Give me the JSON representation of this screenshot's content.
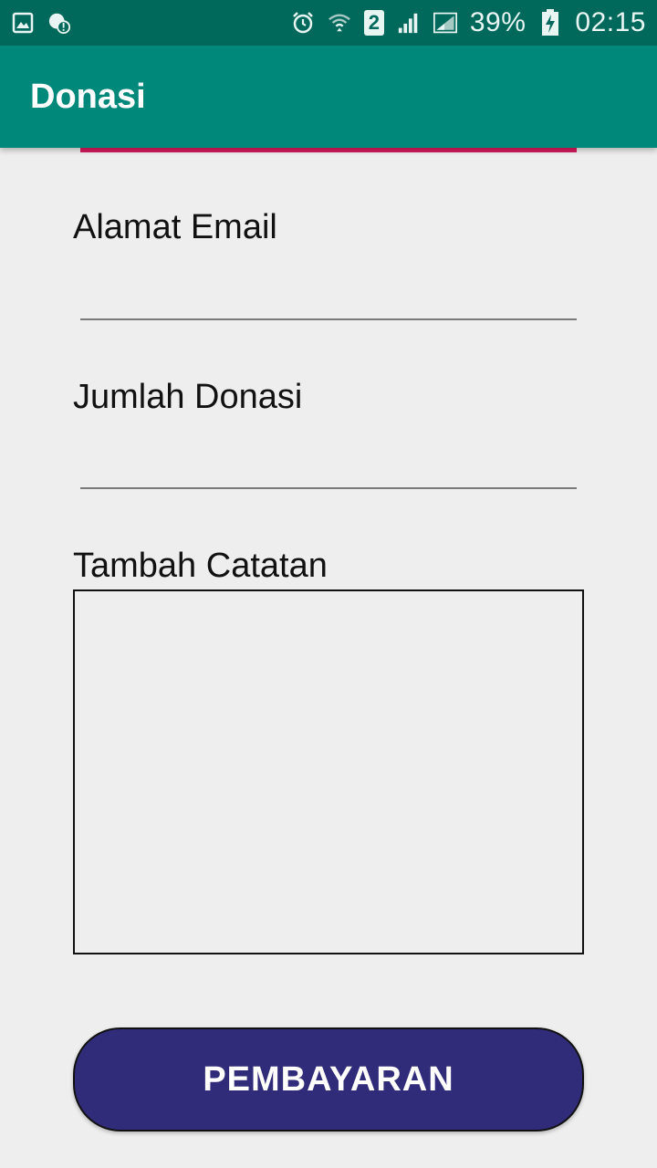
{
  "status_bar": {
    "left_icons": [
      "gallery-icon",
      "notification-alert-icon"
    ],
    "right_icons": [
      "alarm-icon",
      "wifi-icon",
      "sim2-icon",
      "signal-icon",
      "signal2-icon"
    ],
    "sim_label": "2",
    "battery_percent": "39%",
    "time": "02:15"
  },
  "app_bar": {
    "title": "Donasi",
    "color": "#00897b"
  },
  "form": {
    "email_label": "Alamat Email",
    "email_value": "",
    "amount_label": "Jumlah Donasi",
    "amount_value": "",
    "notes_label": "Tambah Catatan",
    "notes_value": ""
  },
  "button": {
    "label": "PEMBAYARAN",
    "color": "#312c7a"
  },
  "colors": {
    "accent": "#d81b60",
    "status_bar": "#00695c"
  }
}
